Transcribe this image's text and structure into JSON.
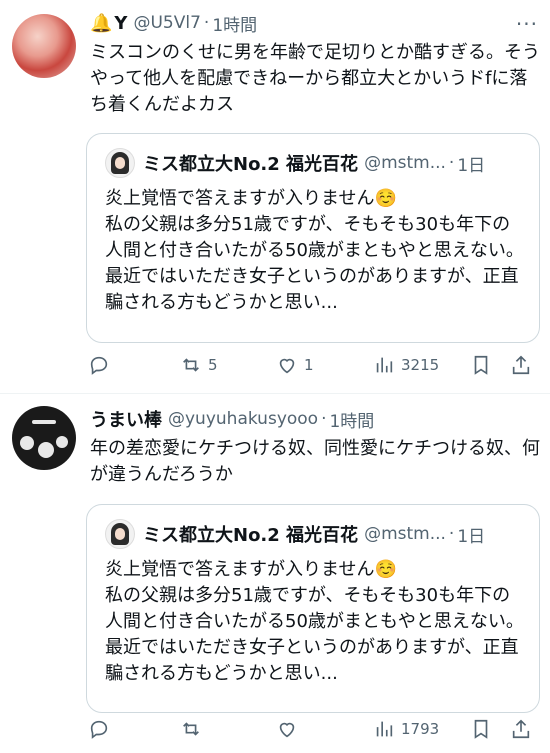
{
  "tweets": [
    {
      "author_bell": "🔔",
      "display_name": "Y",
      "handle": "@U5Vl7",
      "time": "1時間",
      "text": "ミスコンのくせに男を年齢で足切りとか酷すぎる。そうやって他人を配慮できねーから都立大とかいうドfに落ち着くんだよカス",
      "quote": {
        "name": "ミス都立大No.2 福光百花",
        "handle": "@mstm...",
        "time": "1日",
        "lines": [
          "炎上覚悟で答えますが入りません☺️",
          "私の父親は多分51歳ですが、そもそも30も年下の人間と付き合いたがる50歳がまともやと思えない。最近ではいただき女子というのがありますが、正直騙される方もどうかと思い..."
        ]
      },
      "replies": "",
      "retweets": "5",
      "likes": "1",
      "views": "3215"
    },
    {
      "display_name": "うまい棒",
      "handle": "@yuyuhakusyooo",
      "time": "1時間",
      "text": "年の差恋愛にケチつける奴、同性愛にケチつける奴、何が違うんだろうか",
      "quote": {
        "name": "ミス都立大No.2 福光百花",
        "handle": "@mstm...",
        "time": "1日",
        "lines": [
          "炎上覚悟で答えますが入りません☺️",
          "私の父親は多分51歳ですが、そもそも30も年下の人間と付き合いたがる50歳がまともやと思えない。最近ではいただき女子というのがありますが、正直騙される方もどうかと思い..."
        ]
      },
      "replies": "",
      "retweets": "",
      "likes": "",
      "views": "1793"
    }
  ],
  "more_icon": "more-horizontal-icon",
  "colors": {
    "secondary_text": "#536471",
    "border": "#cfd9de",
    "divider": "#eff3f4"
  }
}
